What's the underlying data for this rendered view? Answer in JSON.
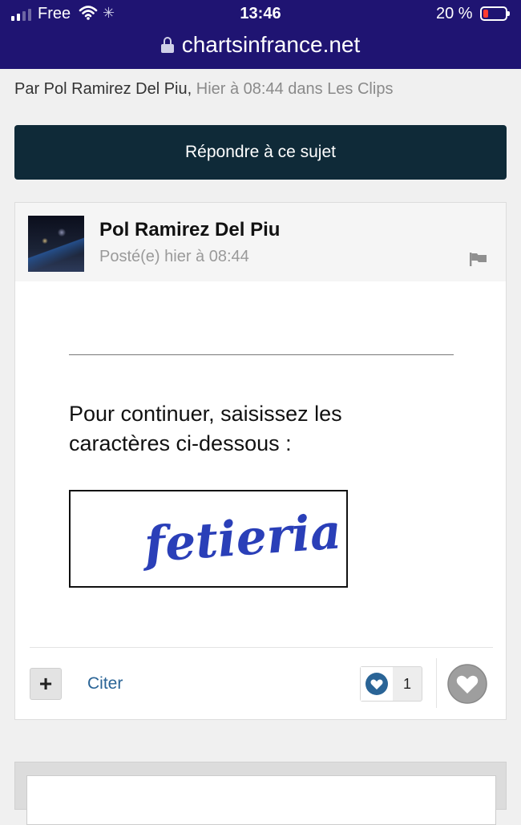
{
  "status_bar": {
    "carrier": "Free",
    "time": "13:46",
    "battery_percent": "20 %",
    "battery_level": 0.2
  },
  "browser": {
    "url": "chartsinfrance.net"
  },
  "topic": {
    "byline_prefix": "Par Pol Ramirez Del Piu,",
    "byline_suffix": "Hier à 08:44 dans Les Clips",
    "reply_button": "Répondre à ce sujet"
  },
  "post": {
    "author": "Pol Ramirez Del Piu",
    "posted": "Posté(e) hier à 08:44",
    "prompt": "Pour continuer, saisissez les caractères ci-dessous :",
    "captcha_text": "fetieria",
    "actions": {
      "plus": "+",
      "cite": "Citer",
      "reaction_count": "1"
    }
  },
  "colors": {
    "header_bg": "#1f1472",
    "reply_button_bg": "#0f2a38",
    "link": "#2a6496",
    "captcha_ink": "#2a3fb8",
    "reaction_heart": "#2a6496"
  },
  "icons": [
    "signal-icon",
    "wifi-icon",
    "loading-icon",
    "battery-icon",
    "lock-icon",
    "flag-icon",
    "heart-icon",
    "react-heart-icon"
  ]
}
